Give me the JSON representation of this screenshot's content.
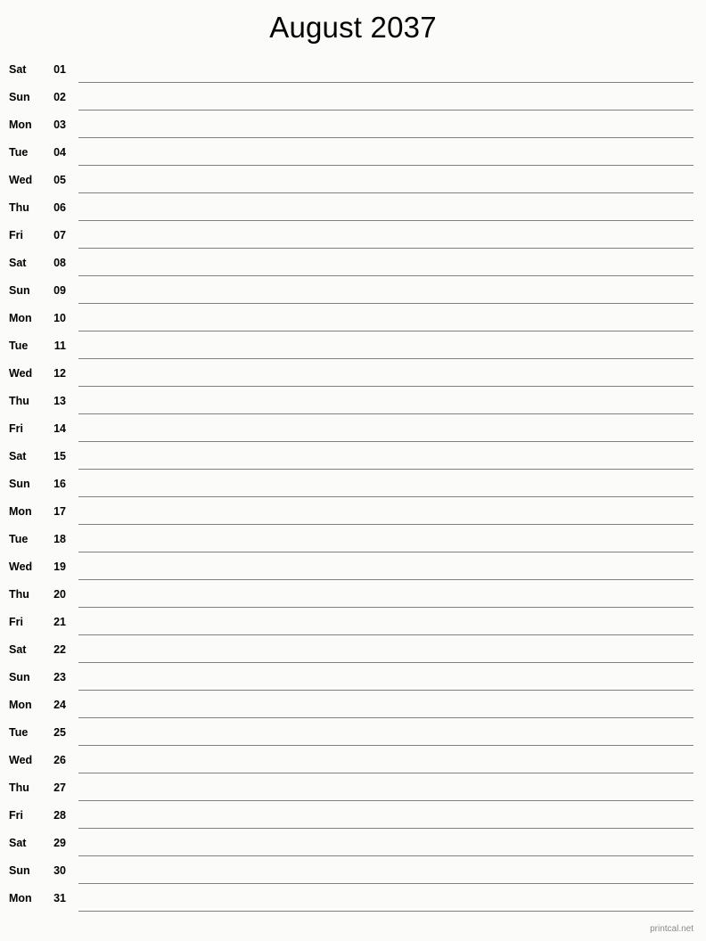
{
  "document": {
    "title": "August 2037",
    "background_color": "#fbfcfa",
    "rule_color": "#808080",
    "text_color": "#000000"
  },
  "calendar": {
    "month": "August",
    "year": "2037",
    "days": [
      {
        "weekday": "Sat",
        "day": "01"
      },
      {
        "weekday": "Sun",
        "day": "02"
      },
      {
        "weekday": "Mon",
        "day": "03"
      },
      {
        "weekday": "Tue",
        "day": "04"
      },
      {
        "weekday": "Wed",
        "day": "05"
      },
      {
        "weekday": "Thu",
        "day": "06"
      },
      {
        "weekday": "Fri",
        "day": "07"
      },
      {
        "weekday": "Sat",
        "day": "08"
      },
      {
        "weekday": "Sun",
        "day": "09"
      },
      {
        "weekday": "Mon",
        "day": "10"
      },
      {
        "weekday": "Tue",
        "day": "11"
      },
      {
        "weekday": "Wed",
        "day": "12"
      },
      {
        "weekday": "Thu",
        "day": "13"
      },
      {
        "weekday": "Fri",
        "day": "14"
      },
      {
        "weekday": "Sat",
        "day": "15"
      },
      {
        "weekday": "Sun",
        "day": "16"
      },
      {
        "weekday": "Mon",
        "day": "17"
      },
      {
        "weekday": "Tue",
        "day": "18"
      },
      {
        "weekday": "Wed",
        "day": "19"
      },
      {
        "weekday": "Thu",
        "day": "20"
      },
      {
        "weekday": "Fri",
        "day": "21"
      },
      {
        "weekday": "Sat",
        "day": "22"
      },
      {
        "weekday": "Sun",
        "day": "23"
      },
      {
        "weekday": "Mon",
        "day": "24"
      },
      {
        "weekday": "Tue",
        "day": "25"
      },
      {
        "weekday": "Wed",
        "day": "26"
      },
      {
        "weekday": "Thu",
        "day": "27"
      },
      {
        "weekday": "Fri",
        "day": "28"
      },
      {
        "weekday": "Sat",
        "day": "29"
      },
      {
        "weekday": "Sun",
        "day": "30"
      },
      {
        "weekday": "Mon",
        "day": "31"
      }
    ]
  },
  "footer": {
    "watermark": "printcal.net"
  }
}
